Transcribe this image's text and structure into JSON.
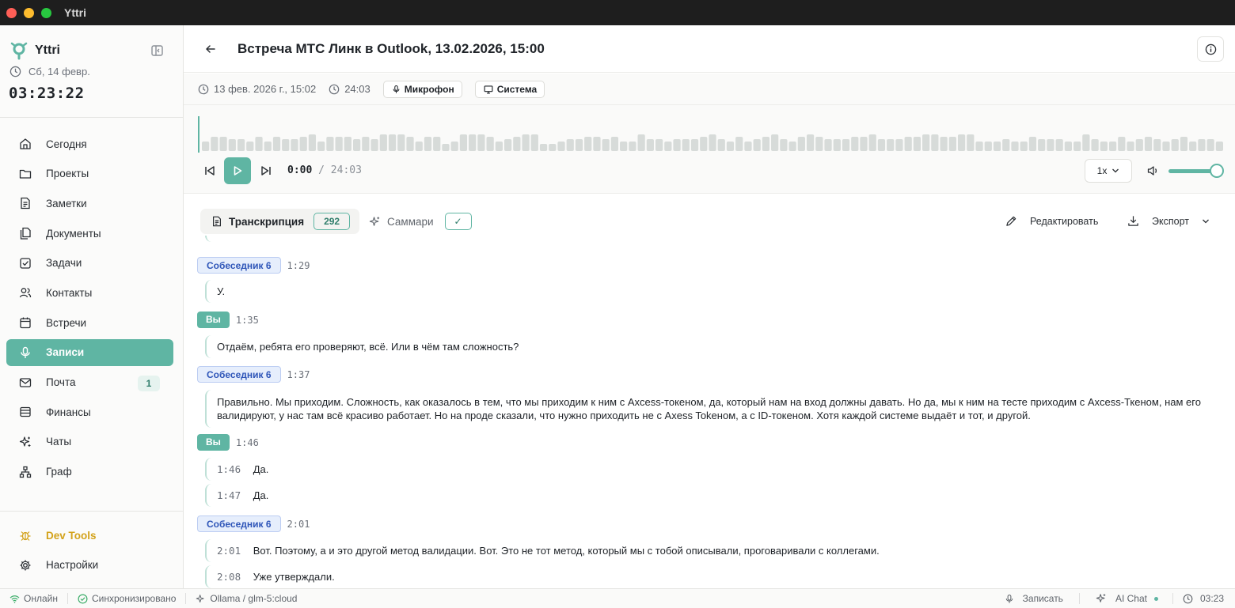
{
  "window": {
    "title": "Yttri"
  },
  "sidebar": {
    "app_name": "Yttri",
    "date": "Сб, 14 февр.",
    "clock": "03:23:22",
    "items": [
      {
        "label": "Сегодня",
        "icon": "home-icon"
      },
      {
        "label": "Проекты",
        "icon": "folder-icon"
      },
      {
        "label": "Заметки",
        "icon": "note-icon"
      },
      {
        "label": "Документы",
        "icon": "documents-icon"
      },
      {
        "label": "Задачи",
        "icon": "task-check-icon"
      },
      {
        "label": "Контакты",
        "icon": "contacts-icon"
      },
      {
        "label": "Встречи",
        "icon": "calendar-icon"
      },
      {
        "label": "Записи",
        "icon": "microphone-icon",
        "active": true
      },
      {
        "label": "Почта",
        "icon": "mail-icon",
        "badge": "1"
      },
      {
        "label": "Финансы",
        "icon": "finance-icon"
      },
      {
        "label": "Чаты",
        "icon": "chats-sparkle-icon"
      },
      {
        "label": "Граф",
        "icon": "graph-icon"
      }
    ],
    "bottom": {
      "devtools": "Dev Tools",
      "settings": "Настройки"
    }
  },
  "header": {
    "title": "Встреча МТС Линк в Outlook, 13.02.2026, 15:00"
  },
  "meta": {
    "datetime": "13 фев. 2026 г., 15:02",
    "duration": "24:03",
    "mic_chip": "Микрофон",
    "system_chip": "Система"
  },
  "player": {
    "current": "0:00",
    "separator": "/",
    "total": "24:03",
    "speed": "1x",
    "volume_fraction": 0.95,
    "waveform_levels": [
      0.4,
      0.6,
      0.6,
      0.5,
      0.5,
      0.4,
      0.6,
      0.4,
      0.6,
      0.5,
      0.5,
      0.6,
      0.7,
      0.4,
      0.6,
      0.6,
      0.6,
      0.5,
      0.6,
      0.5,
      0.7,
      0.7,
      0.7,
      0.6,
      0.4,
      0.6,
      0.6,
      0.3,
      0.4,
      0.7,
      0.7,
      0.7,
      0.6,
      0.4,
      0.5,
      0.6,
      0.7,
      0.7,
      0.3,
      0.3,
      0.4,
      0.5,
      0.5,
      0.6,
      0.6,
      0.5,
      0.6,
      0.4,
      0.4,
      0.7,
      0.5,
      0.5,
      0.4,
      0.5,
      0.5,
      0.5,
      0.6,
      0.7,
      0.5,
      0.4,
      0.6,
      0.4,
      0.5,
      0.6,
      0.7,
      0.5,
      0.4,
      0.6,
      0.7,
      0.6,
      0.5,
      0.5,
      0.5,
      0.6,
      0.6,
      0.7,
      0.5,
      0.5,
      0.5,
      0.6,
      0.6,
      0.7,
      0.7,
      0.6,
      0.6,
      0.7,
      0.7,
      0.4,
      0.4,
      0.4,
      0.5,
      0.4,
      0.4,
      0.6,
      0.5,
      0.5,
      0.5,
      0.4,
      0.4,
      0.7,
      0.5,
      0.4,
      0.4,
      0.6,
      0.4,
      0.5,
      0.6,
      0.5,
      0.4,
      0.5,
      0.6,
      0.4,
      0.5,
      0.5,
      0.4
    ]
  },
  "tabs": {
    "transcript_label": "Транскрипция",
    "transcript_count": "292",
    "summary_label": "Саммари",
    "summary_check": "✓",
    "edit_label": "Редактировать",
    "export_label": "Экспорт"
  },
  "transcript": [
    {
      "speaker": "Собеседник 6",
      "you": false,
      "time": "1:29",
      "lines": [
        {
          "text": "У."
        }
      ]
    },
    {
      "speaker": "Вы",
      "you": true,
      "time": "1:35",
      "lines": [
        {
          "text": "Отдаём, ребята его проверяют, всё. Или в чём там сложность?"
        }
      ]
    },
    {
      "speaker": "Собеседник 6",
      "you": false,
      "time": "1:37",
      "lines": [
        {
          "text": "Правильно. Мы приходим. Сложность, как оказалось в тем, что мы приходим к ним с Axcess-токеном, да, который нам на вход должны давать. Но да, мы к ним на тесте приходим с Axcess-Ткеном, нам его валидируют, у нас там всё красиво работает. Но на проде сказали, что нужно приходить не с Axess Tokeном, а с ID-токеном. Хотя каждой системе выдаёт и тот, и другой."
        }
      ]
    },
    {
      "speaker": "Вы",
      "you": true,
      "time": "1:46",
      "lines": [
        {
          "time": "1:46",
          "text": "Да."
        },
        {
          "time": "1:47",
          "text": "Да."
        }
      ]
    },
    {
      "speaker": "Собеседник 6",
      "you": false,
      "time": "2:01",
      "lines": [
        {
          "time": "2:01",
          "text": "Вот. Поэтому, а и это другой метод валидации. Вот. Это не тот метод, который мы с тобой описывали, проговаривали с коллегами."
        },
        {
          "time": "2:08",
          "text": "Уже утверждали."
        }
      ]
    }
  ],
  "status": {
    "online": "Онлайн",
    "synced": "Синхронизировано",
    "model": "Ollama / glm-5:cloud",
    "record": "Записать",
    "ai_chat": "AI Chat",
    "time": "03:23"
  },
  "colors": {
    "accent": "#5fb5a3",
    "speaker_other": "#2e55b8",
    "devtools": "#d3a21a"
  }
}
